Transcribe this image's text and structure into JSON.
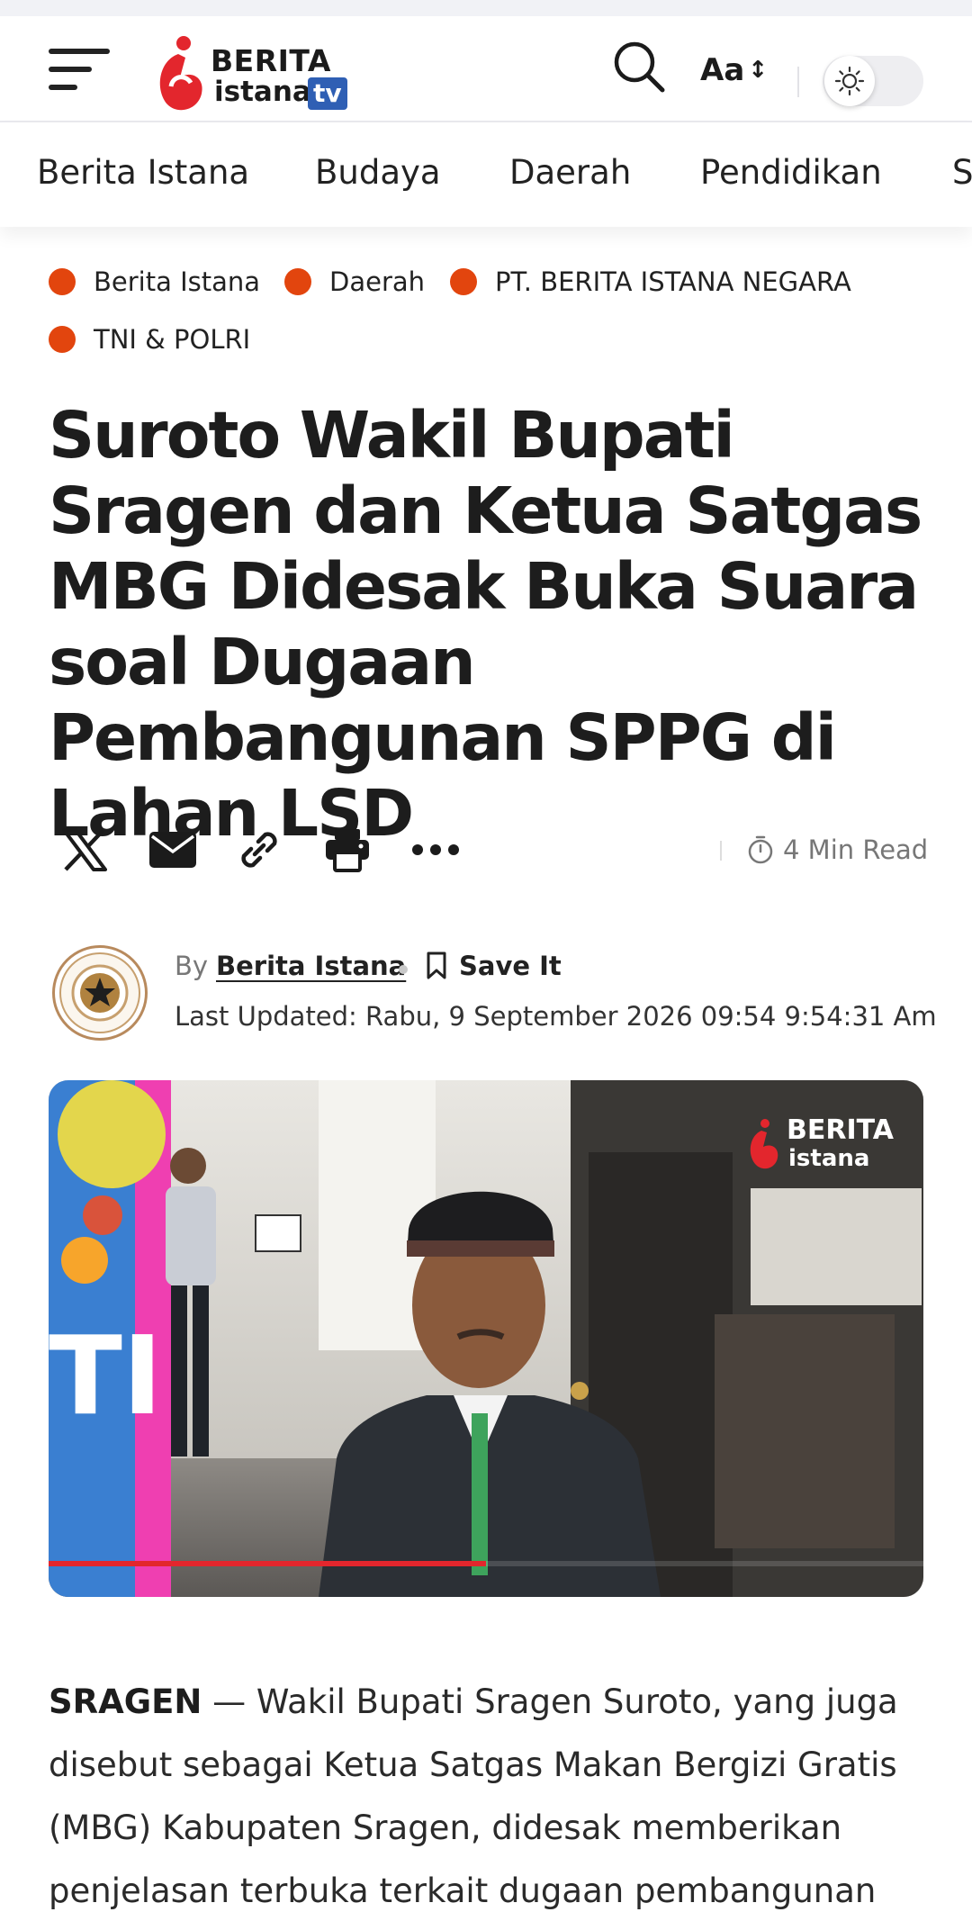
{
  "header": {
    "logo": {
      "line1": "BERITA",
      "line2": "istana",
      "badge": "tv"
    },
    "font_button": {
      "label": "Aa",
      "arrows": "↕"
    },
    "theme_toggle": {
      "state": "light"
    },
    "icons": [
      "menu-icon",
      "search-icon",
      "sun-icon"
    ]
  },
  "nav": {
    "items": [
      "Berita Istana",
      "Budaya",
      "Daerah",
      "Pendidikan",
      "S"
    ]
  },
  "article": {
    "categories": [
      "Berita Istana",
      "Daerah",
      "PT. BERITA ISTANA NEGARA",
      "TNI & POLRI"
    ],
    "category_dot_color": "#e2450e",
    "title": "Suroto Wakil Bupati Sragen dan Ketua Satgas MBG Didesak Buka Suara soal Dugaan Pembangunan SPPG di Lahan LSD",
    "share_icons": [
      "x-icon",
      "email-icon",
      "link-icon",
      "print-icon",
      "more-icon"
    ],
    "read_time": "4 Min Read",
    "author": {
      "by_label": "By",
      "name": "Berita Istana",
      "save_label": "Save It",
      "updated": "Last Updated: Rabu, 9 September 2026 09:54 9:54:31 Am"
    },
    "hero": {
      "watermark_line1": "BERITA",
      "watermark_line2": "istana",
      "video_progress": 0.5,
      "progress_color": "#e3262d"
    },
    "body": {
      "lead": "SRAGEN",
      "text": " — Wakil Bupati Sragen Suroto, yang juga disebut sebagai Ketua Satgas Makan Bergizi Gratis (MBG) Kabupaten Sragen, didesak memberikan penjelasan terbuka terkait dugaan pembangunan"
    }
  }
}
